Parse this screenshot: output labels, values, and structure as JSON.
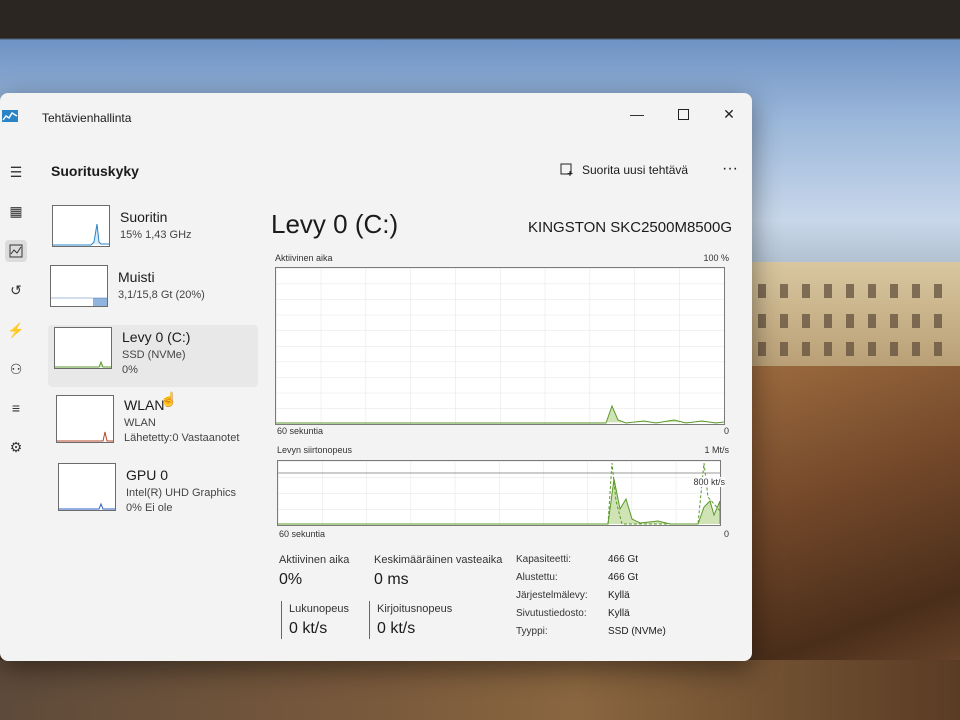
{
  "window": {
    "title": "Tehtävienhallinta"
  },
  "header": {
    "section_title": "Suorituskyky",
    "run_task_label": "Suorita uusi tehtävä",
    "more_label": "···"
  },
  "devices": [
    {
      "name": "Suoritin",
      "sub1": "15% 1,43 GHz",
      "sub2": "",
      "usage": 0.15
    },
    {
      "name": "Muisti",
      "sub1": "3,1/15,8 Gt (20%)",
      "sub2": "",
      "usage": 0.2
    },
    {
      "name": "Levy 0 (C:)",
      "sub1": "SSD (NVMe)",
      "sub2": "0%",
      "usage": 0.0
    },
    {
      "name": "WLAN",
      "sub1": "WLAN",
      "sub2": "Lähetetty:0 Vastaanotet",
      "usage": 0.0
    },
    {
      "name": "GPU 0",
      "sub1": "Intel(R) UHD Graphics",
      "sub2": "0% Ei ole",
      "usage": 0.0
    }
  ],
  "main": {
    "title": "Levy 0 (C:)",
    "model": "KINGSTON SKC2500M8500G",
    "graph1": {
      "label": "Aktiivinen aika",
      "max": "100 %",
      "time": "60 sekuntia",
      "min": "0"
    },
    "graph2": {
      "label": "Levyn siirtonopeus",
      "max": "1 Mt/s",
      "mid": "800 kt/s",
      "time": "60 sekuntia",
      "min": "0"
    },
    "stats": {
      "active_time_label": "Aktiivinen aika",
      "active_time_value": "0%",
      "response_label": "Keskimääräinen vasteaika",
      "response_value": "0 ms",
      "read_label": "Lukunopeus",
      "read_value": "0 kt/s",
      "write_label": "Kirjoitusnopeus",
      "write_value": "0 kt/s"
    },
    "properties": [
      {
        "key": "Kapasiteetti:",
        "value": "466 Gt"
      },
      {
        "key": "Alustettu:",
        "value": "466 Gt"
      },
      {
        "key": "Järjestelmälevy:",
        "value": "Kyllä"
      },
      {
        "key": "Sivutustiedosto:",
        "value": "Kyllä"
      },
      {
        "key": "Tyyppi:",
        "value": "SSD (NVMe)"
      }
    ]
  },
  "colors": {
    "disk_fill": "#cfe3b5",
    "disk_line": "#5a9a2a",
    "cpu_line": "#2a84c6",
    "selection": "#e8e8e8"
  }
}
